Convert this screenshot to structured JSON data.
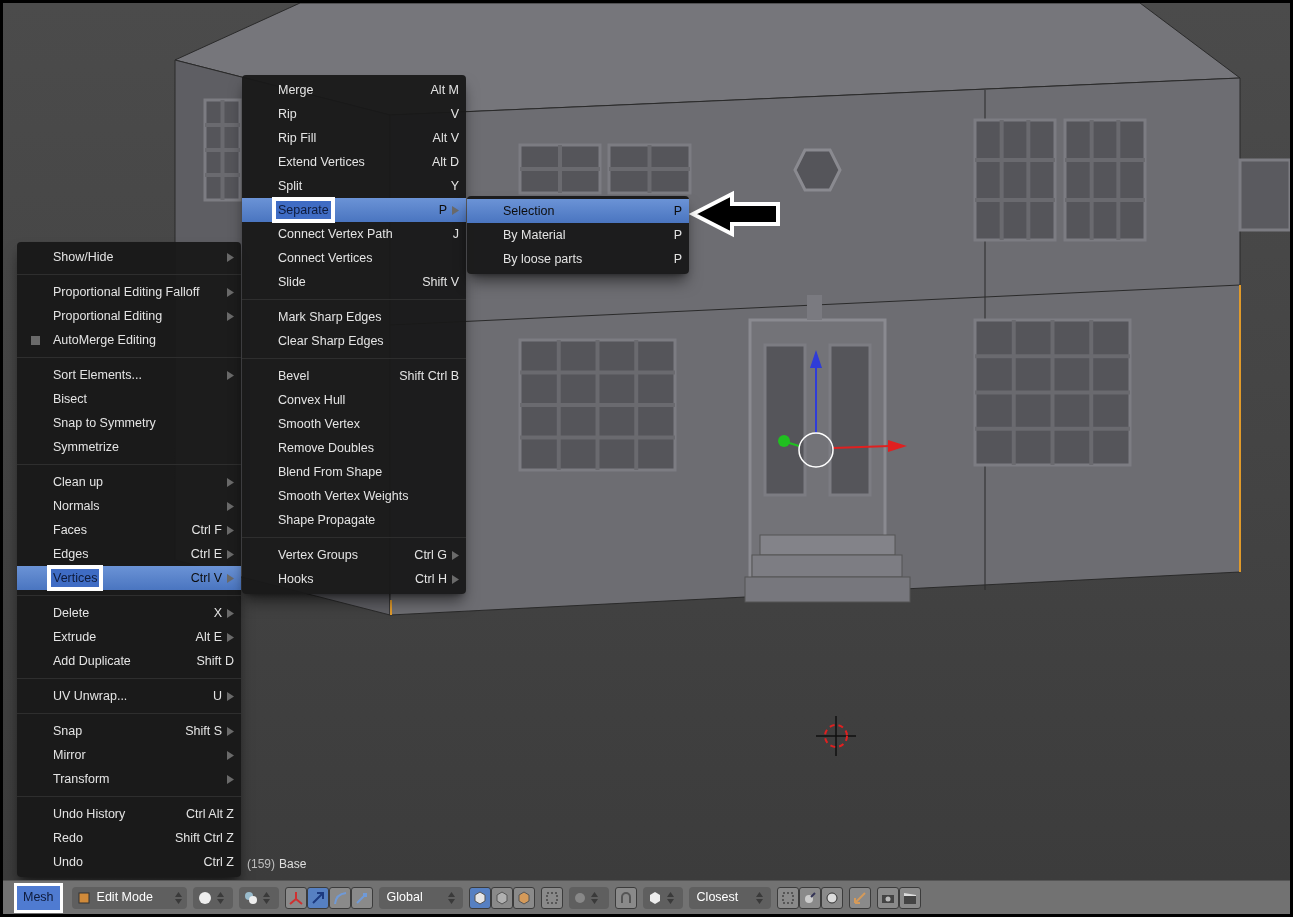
{
  "menus": [
    {
      "items": [
        {
          "kind": "item",
          "label": "Show/Hide",
          "submenu": true,
          "selected": false,
          "callout": false
        },
        {
          "kind": "separator"
        },
        {
          "kind": "item",
          "label": "Proportional Editing Falloff",
          "submenu": true,
          "selected": false,
          "callout": false
        },
        {
          "kind": "item",
          "label": "Proportional Editing",
          "submenu": true,
          "selected": false,
          "callout": false
        },
        {
          "kind": "checkbox",
          "label": "AutoMerge Editing",
          "checked": false,
          "submenu": false,
          "selected": false,
          "callout": false
        },
        {
          "kind": "separator"
        },
        {
          "kind": "item",
          "label": "Sort Elements...",
          "submenu": true,
          "selected": false,
          "callout": false
        },
        {
          "kind": "item",
          "label": "Bisect",
          "submenu": false,
          "selected": false,
          "callout": false
        },
        {
          "kind": "item",
          "label": "Snap to Symmetry",
          "submenu": false,
          "selected": false,
          "callout": false
        },
        {
          "kind": "item",
          "label": "Symmetrize",
          "submenu": false,
          "selected": false,
          "callout": false
        },
        {
          "kind": "separator"
        },
        {
          "kind": "item",
          "label": "Clean up",
          "submenu": true,
          "selected": false,
          "callout": false
        },
        {
          "kind": "item",
          "label": "Normals",
          "submenu": true,
          "selected": false,
          "callout": false
        },
        {
          "kind": "item",
          "label": "Faces",
          "shortcut": "Ctrl F",
          "submenu": true,
          "selected": false,
          "callout": false
        },
        {
          "kind": "item",
          "label": "Edges",
          "shortcut": "Ctrl E",
          "submenu": true,
          "selected": false,
          "callout": false
        },
        {
          "kind": "item",
          "label": "Vertices",
          "shortcut": "Ctrl V",
          "submenu": true,
          "selected": true,
          "callout": true
        },
        {
          "kind": "separator"
        },
        {
          "kind": "item",
          "label": "Delete",
          "shortcut": "X",
          "submenu": true,
          "selected": false,
          "callout": false
        },
        {
          "kind": "item",
          "label": "Extrude",
          "shortcut": "Alt E",
          "submenu": true,
          "selected": false,
          "callout": false
        },
        {
          "kind": "item",
          "label": "Add Duplicate",
          "shortcut": "Shift D",
          "submenu": false,
          "selected": false,
          "callout": false
        },
        {
          "kind": "separator"
        },
        {
          "kind": "item",
          "label": "UV Unwrap...",
          "shortcut": "U",
          "submenu": true,
          "selected": false,
          "callout": false
        },
        {
          "kind": "separator"
        },
        {
          "kind": "item",
          "label": "Snap",
          "shortcut": "Shift S",
          "submenu": true,
          "selected": false,
          "callout": false
        },
        {
          "kind": "item",
          "label": "Mirror",
          "submenu": true,
          "selected": false,
          "callout": false
        },
        {
          "kind": "item",
          "label": "Transform",
          "submenu": true,
          "selected": false,
          "callout": false
        },
        {
          "kind": "separator"
        },
        {
          "kind": "item",
          "label": "Undo History",
          "shortcut": "Ctrl Alt Z",
          "submenu": false,
          "selected": false,
          "callout": false
        },
        {
          "kind": "item",
          "label": "Redo",
          "shortcut": "Shift Ctrl Z",
          "submenu": false,
          "selected": false,
          "callout": false
        },
        {
          "kind": "item",
          "label": "Undo",
          "shortcut": "Ctrl Z",
          "submenu": false,
          "selected": false,
          "callout": false
        }
      ]
    },
    {
      "items": [
        {
          "kind": "item",
          "label": "Merge",
          "shortcut": "Alt M",
          "submenu": false,
          "selected": false,
          "callout": false
        },
        {
          "kind": "item",
          "label": "Rip",
          "shortcut": "V",
          "submenu": false,
          "selected": false,
          "callout": false
        },
        {
          "kind": "item",
          "label": "Rip Fill",
          "shortcut": "Alt V",
          "submenu": false,
          "selected": false,
          "callout": false
        },
        {
          "kind": "item",
          "label": "Extend Vertices",
          "shortcut": "Alt D",
          "submenu": false,
          "selected": false,
          "callout": false
        },
        {
          "kind": "item",
          "label": "Split",
          "shortcut": "Y",
          "submenu": false,
          "selected": false,
          "callout": false
        },
        {
          "kind": "item",
          "label": "Separate",
          "shortcut": "P",
          "submenu": true,
          "selected": true,
          "callout": true
        },
        {
          "kind": "item",
          "label": "Connect Vertex Path",
          "shortcut": "J",
          "submenu": false,
          "selected": false,
          "callout": false
        },
        {
          "kind": "item",
          "label": "Connect Vertices",
          "submenu": false,
          "selected": false,
          "callout": false
        },
        {
          "kind": "item",
          "label": "Slide",
          "shortcut": "Shift V",
          "submenu": false,
          "selected": false,
          "callout": false
        },
        {
          "kind": "separator"
        },
        {
          "kind": "item",
          "label": "Mark Sharp Edges",
          "submenu": false,
          "selected": false,
          "callout": false
        },
        {
          "kind": "item",
          "label": "Clear Sharp Edges",
          "submenu": false,
          "selected": false,
          "callout": false
        },
        {
          "kind": "separator"
        },
        {
          "kind": "item",
          "label": "Bevel",
          "shortcut": "Shift Ctrl B",
          "submenu": false,
          "selected": false,
          "callout": false
        },
        {
          "kind": "item",
          "label": "Convex Hull",
          "submenu": false,
          "selected": false,
          "callout": false
        },
        {
          "kind": "item",
          "label": "Smooth Vertex",
          "submenu": false,
          "selected": false,
          "callout": false
        },
        {
          "kind": "item",
          "label": "Remove Doubles",
          "submenu": false,
          "selected": false,
          "callout": false
        },
        {
          "kind": "item",
          "label": "Blend From Shape",
          "submenu": false,
          "selected": false,
          "callout": false
        },
        {
          "kind": "item",
          "label": "Smooth Vertex Weights",
          "submenu": false,
          "selected": false,
          "callout": false
        },
        {
          "kind": "item",
          "label": "Shape Propagate",
          "submenu": false,
          "selected": false,
          "callout": false
        },
        {
          "kind": "separator"
        },
        {
          "kind": "item",
          "label": "Vertex Groups",
          "shortcut": "Ctrl G",
          "submenu": true,
          "selected": false,
          "callout": false
        },
        {
          "kind": "item",
          "label": "Hooks",
          "shortcut": "Ctrl H",
          "submenu": true,
          "selected": false,
          "callout": false
        }
      ]
    },
    {
      "items": [
        {
          "kind": "item",
          "label": "Selection",
          "shortcut": "P",
          "submenu": false,
          "selected": true,
          "callout": false
        },
        {
          "kind": "item",
          "label": "By Material",
          "shortcut": "P",
          "submenu": false,
          "selected": false,
          "callout": false
        },
        {
          "kind": "item",
          "label": "By loose parts",
          "shortcut": "P",
          "submenu": false,
          "selected": false,
          "callout": false
        }
      ]
    }
  ],
  "viewport": {
    "frame": "(159)",
    "object_name": "Base"
  },
  "header": {
    "menu_button": {
      "label": "Mesh",
      "selected": true
    },
    "mode": {
      "label": "Edit Mode"
    },
    "manipulators": [
      {
        "selected": false
      },
      {
        "selected": true
      },
      {
        "selected": false
      },
      {
        "selected": false
      }
    ],
    "orientation": {
      "label": "Global"
    },
    "select_modes": [
      {
        "selected": true
      },
      {
        "selected": false
      },
      {
        "selected": false
      }
    ],
    "snap_target": {
      "label": "Closest"
    }
  }
}
